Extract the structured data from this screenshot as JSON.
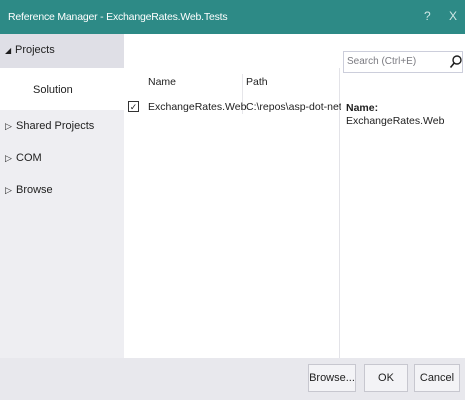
{
  "window": {
    "title": "Reference Manager - ExchangeRates.Web.Tests",
    "help_glyph": "?",
    "close_glyph": "X",
    "accent": "#2d8a86"
  },
  "sidebar": {
    "header": {
      "label": "Projects",
      "icon": "expanded-triangle-icon"
    },
    "selected": {
      "label": "Solution"
    },
    "items": [
      {
        "label": "Shared Projects",
        "icon": "collapsed-triangle-icon"
      },
      {
        "label": "COM",
        "icon": "collapsed-triangle-icon"
      },
      {
        "label": "Browse",
        "icon": "collapsed-triangle-icon"
      }
    ]
  },
  "grid": {
    "columns": [
      "Name",
      "Path"
    ],
    "rows": [
      {
        "checked": true,
        "check_glyph": "✓",
        "name": "ExchangeRates.Web",
        "path": "C:\\repos\\asp-dot-net-c..."
      }
    ]
  },
  "search": {
    "placeholder": "Search (Ctrl+E)",
    "icon": "search-icon"
  },
  "details": {
    "name_label": "Name:",
    "name_value": "ExchangeRates.Web"
  },
  "footer": {
    "browse_label": "Browse...",
    "ok_label": "OK",
    "cancel_label": "Cancel"
  }
}
